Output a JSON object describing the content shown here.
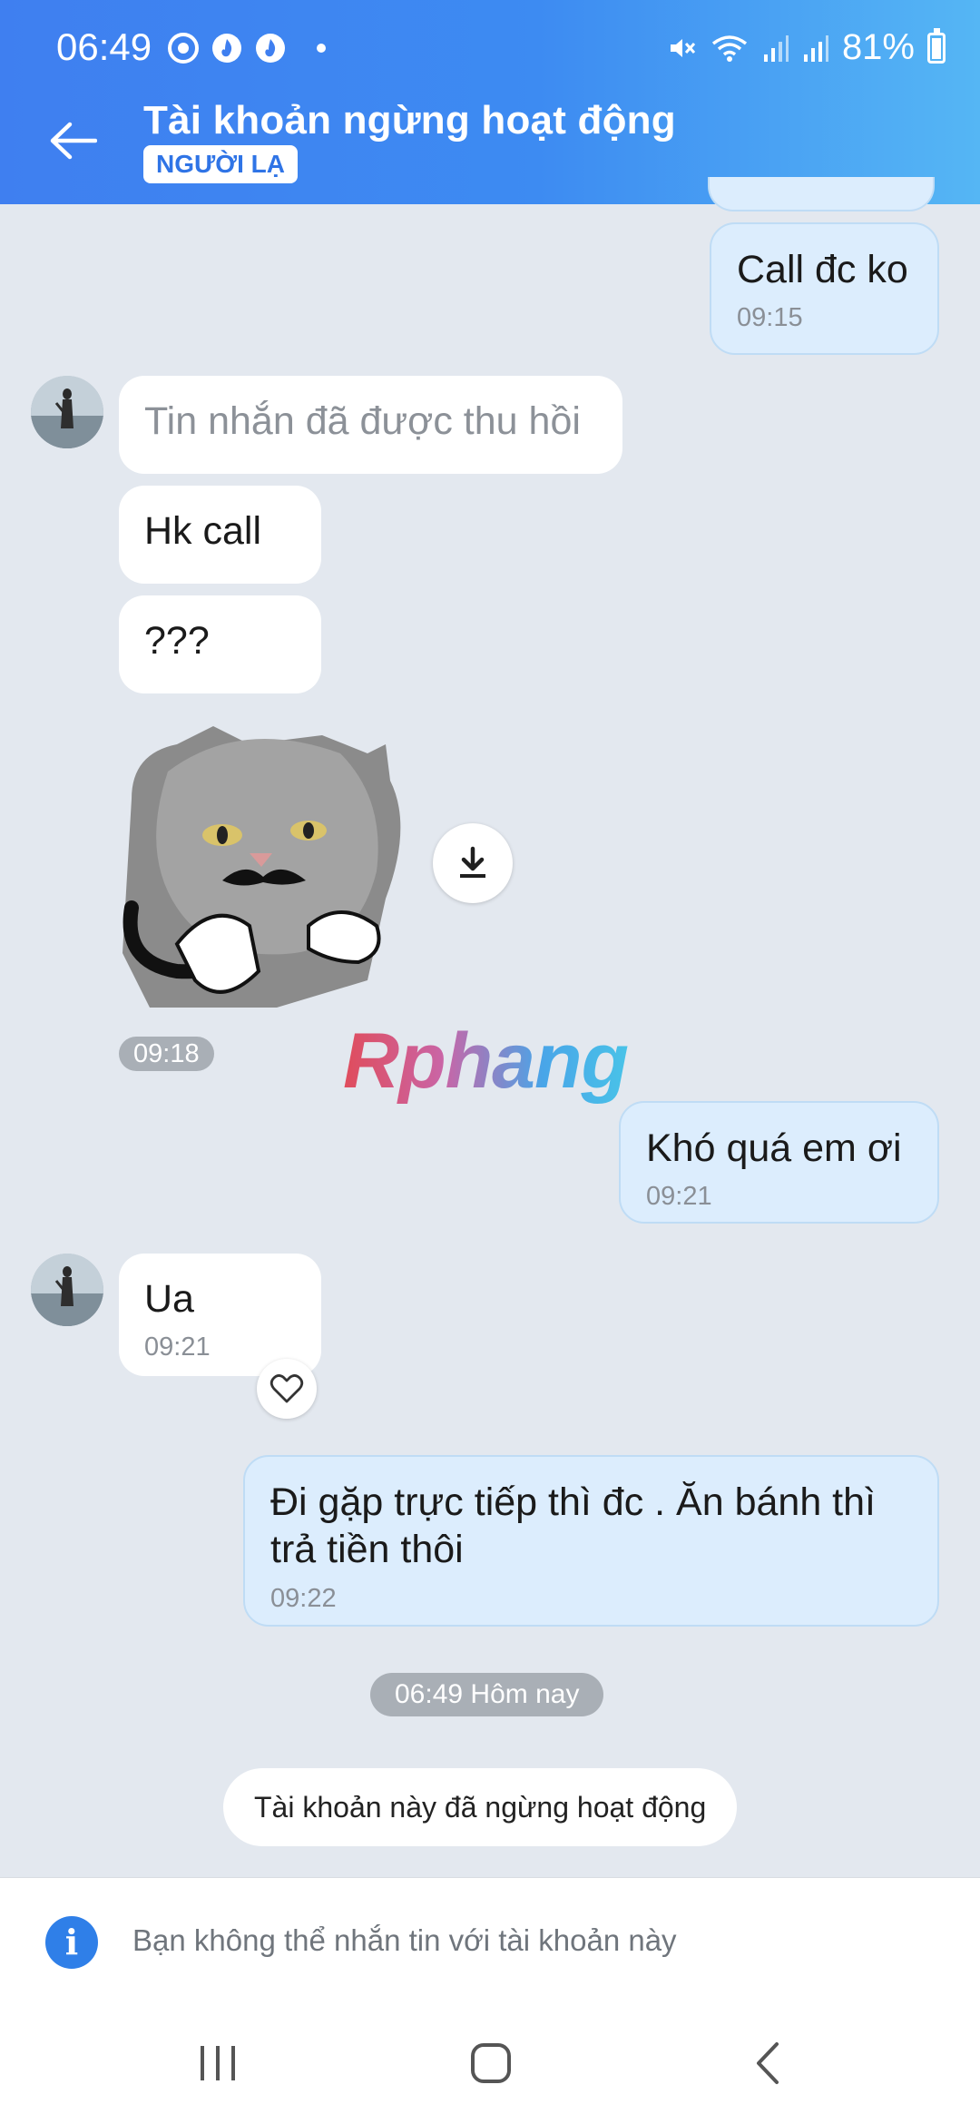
{
  "status_bar": {
    "time": "06:49",
    "battery": "81%",
    "battery_level": 0.81
  },
  "header": {
    "title": "Tài khoản ngừng hoạt động",
    "badge": "NGƯỜI LẠ"
  },
  "messages": [
    {
      "dir": "out",
      "text": "Call đc ko",
      "time": "09:15"
    },
    {
      "dir": "in",
      "text": "Tin nhắn đã được thu hồi",
      "recalled": true
    },
    {
      "dir": "in",
      "text": "Hk call"
    },
    {
      "dir": "in",
      "text": "???"
    },
    {
      "dir": "in",
      "type": "sticker",
      "time": "09:18"
    },
    {
      "dir": "out",
      "text": "Khó quá em ơi",
      "time": "09:21"
    },
    {
      "dir": "in",
      "text": "Ua",
      "time": "09:21"
    },
    {
      "dir": "out",
      "text": "Đi gặp trực tiếp thì đc . Ăn bánh thì trả tiền thôi",
      "time": "09:22"
    }
  ],
  "watermark": "Rphang",
  "date_divider": "06:49 Hôm nay",
  "system_message": "Tài khoản này đã ngừng hoạt động",
  "notice": "Bạn không thể nhắn tin với tài khoản này",
  "colors": {
    "header_start": "#3f7ff0",
    "header_end": "#55b6f4",
    "outgoing_bubble": "#dcedfd",
    "chat_background": "#e3e8ef"
  }
}
